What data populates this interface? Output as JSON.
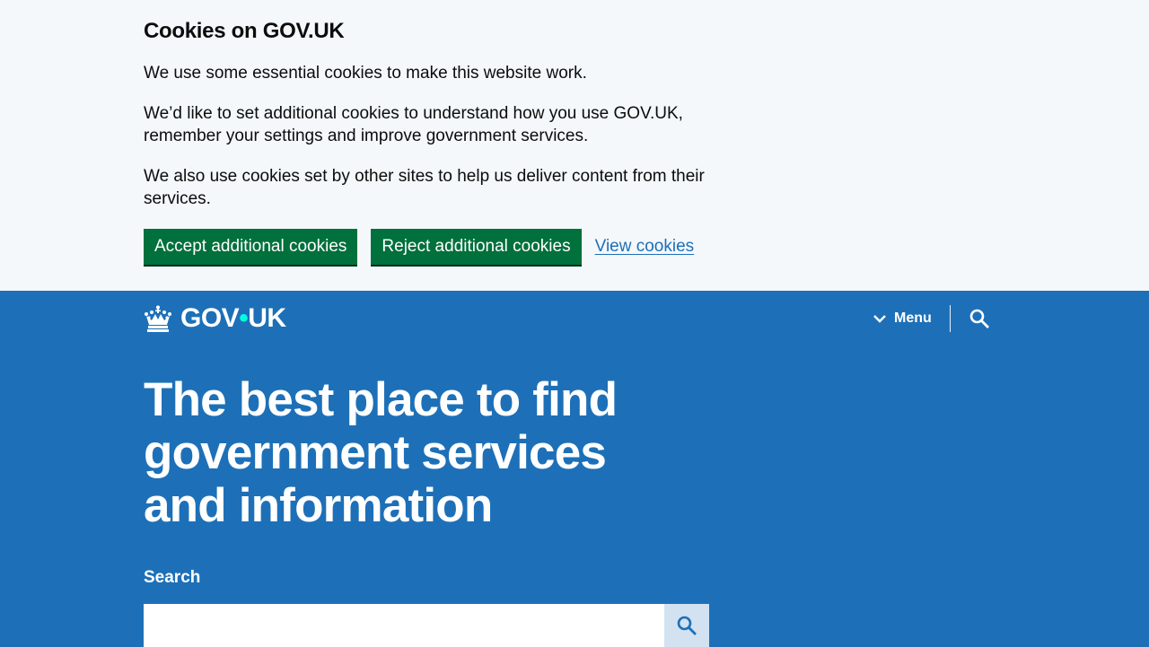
{
  "cookie_banner": {
    "title": "Cookies on GOV.UK",
    "paragraphs": [
      "We use some essential cookies to make this website work.",
      "We’d like to set additional cookies to understand how you use GOV.UK, remember your settings and improve government services.",
      "We also use cookies set by other sites to help us deliver content from their services."
    ],
    "accept_label": "Accept additional cookies",
    "reject_label": "Reject additional cookies",
    "view_label": "View cookies"
  },
  "header": {
    "logo_part1": "GOV",
    "logo_dot": "•",
    "logo_part2": "UK",
    "menu_label": "Menu"
  },
  "hero": {
    "title": "The best place to find government services and information"
  },
  "search": {
    "label": "Search",
    "value": "",
    "placeholder": ""
  },
  "colors": {
    "brand_blue": "#1d70b8",
    "button_green": "#00703c",
    "banner_bg": "#f4f8fb",
    "logo_dot": "#00ffe0",
    "search_button_bg": "#d2e2f1"
  },
  "icons": {
    "logo": "crown-icon",
    "menu": "chevron-down-icon",
    "search_toggle": "search-icon",
    "search_submit": "search-icon"
  }
}
